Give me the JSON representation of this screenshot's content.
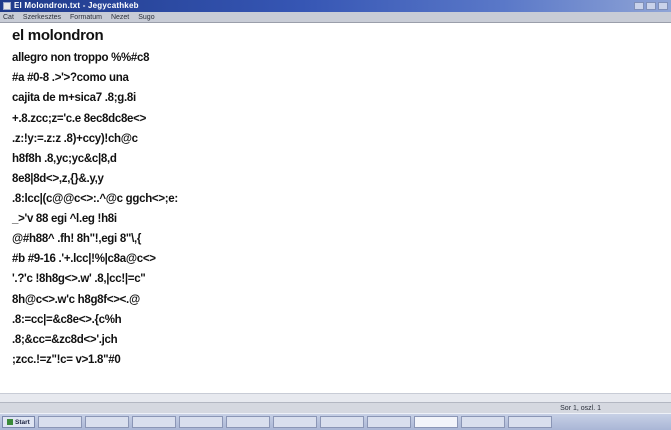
{
  "window": {
    "title": "El Molondron.txt - Jegycathkeb"
  },
  "menu": {
    "items": [
      "Cat",
      "Szerkesztes",
      "Formatum",
      "Nezet",
      "Sugo"
    ]
  },
  "document": {
    "lines": [
      "el molondron",
      "allegro non troppo %%#c8",
      "#a #0-8 .>'>?como una",
      "cajita de m+sica7 .8;g.8i",
      "+.8.zcc;z='c.e 8ec8dc8e<>",
      ".z:!y:=.z:z .8)+ccy)!ch@c",
      "h8f8h .8,yc;yc&c|8,d",
      "8e8|8d<>,z,{}&.y,y",
      ".8:lcc|(c@@c<>:.^@c ggch<>;e:",
      "_>'v 88 egi ^l.eg !h8i",
      "@#h88^ .fh! 8h\"!,egi 8\"\\,{",
      "#b #9-16 .'+.lcc|!%|c8a@c<>",
      "'.?'c !8h8g<>.w' .8,|cc!|=c\"",
      "8h@c<>.w'c h8g8f<><.@",
      ".8:=cc|=&c8e<>.{c%h",
      ".8;&cc=&zc8d<>'.jch",
      ";zcc.!=z\"!c= v>1.8\"#0"
    ]
  },
  "statusbar": {
    "text": "Sor 1, oszl. 1"
  },
  "taskbar": {
    "start_label": "Start",
    "tasks": [
      "",
      "",
      "",
      "",
      "",
      "",
      "",
      "",
      "",
      "",
      ""
    ],
    "clock": ""
  }
}
